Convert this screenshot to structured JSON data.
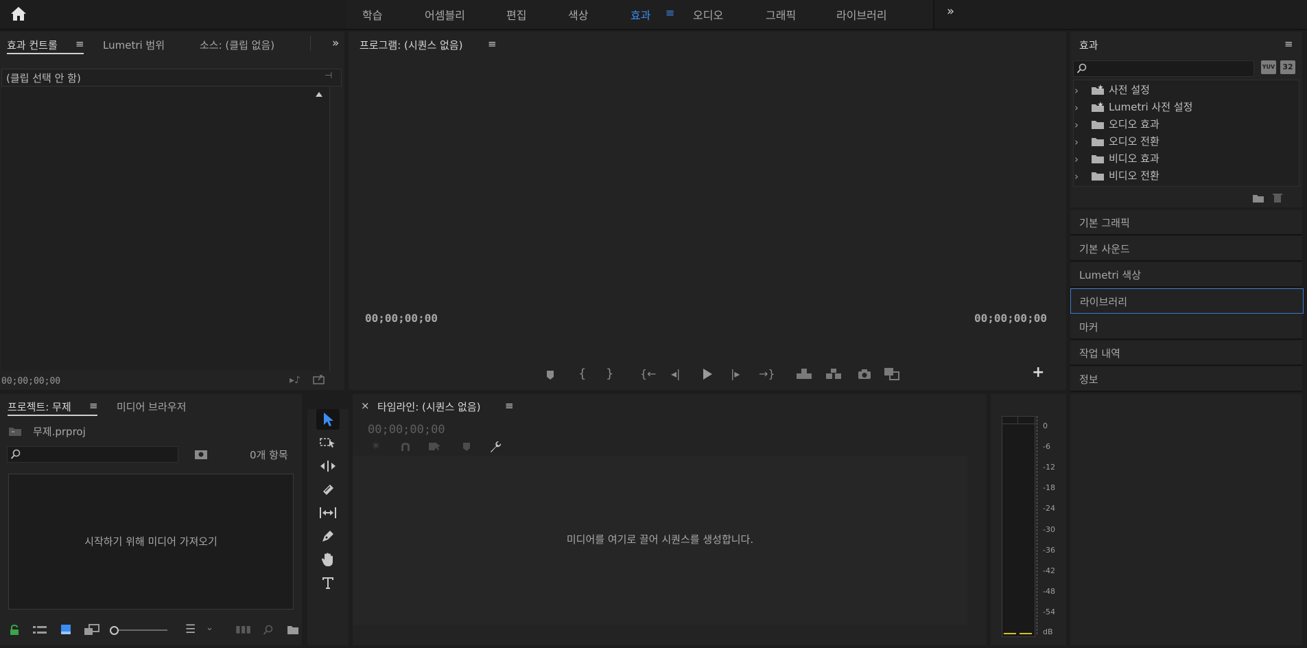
{
  "workspace": {
    "tabs": [
      "학습",
      "어셈블리",
      "편집",
      "색상",
      "효과",
      "오디오",
      "그래픽",
      "라이브러리"
    ],
    "active": "효과",
    "overflow_icon": "chevrons-right-icon",
    "home_icon": "home-icon"
  },
  "left_panel": {
    "tabs": [
      "효과 컨트롤",
      "Lumetri 범위",
      "소스: (클립 없음)"
    ],
    "clip_status": "(클립 선택 안 함)",
    "timecode": "00;00;00;00"
  },
  "program": {
    "title": "프로그램: (시퀀스 없음)",
    "tc_left": "00;00;00;00",
    "tc_right": "00;00;00;00"
  },
  "effects": {
    "title": "효과",
    "search_placeholder": "",
    "items": [
      "사전 설정",
      "Lumetri 사전 설정",
      "오디오 효과",
      "오디오 전환",
      "비디오 효과",
      "비디오 전환"
    ],
    "badge_32": "32",
    "badge_yuv": "YUV"
  },
  "side_panels": [
    "기본 그래픽",
    "기본 사운드",
    "Lumetri 색상",
    "라이브러리",
    "마커",
    "작업 내역",
    "정보"
  ],
  "project": {
    "tabs": [
      "프로젝트: 무제",
      "미디어 브라우저"
    ],
    "file": "무제.prproj",
    "count": "0개 항목",
    "import_hint": "시작하기 위해 미디어 가져오기",
    "search_placeholder": ""
  },
  "timeline": {
    "close": "×",
    "title": "타임라인: (시퀀스 없음)",
    "timecode": "00;00;00;00",
    "drop_hint": "미디어를 여기로 끌어 시퀀스를 생성합니다."
  },
  "meter": {
    "labels": [
      "0",
      "-6",
      "-12",
      "-18",
      "-24",
      "-30",
      "-36",
      "-42",
      "-48",
      "-54",
      "dB"
    ]
  },
  "colors": {
    "accent": "#3b8df0",
    "panel": "#232323",
    "background": "#1d1d1d"
  }
}
